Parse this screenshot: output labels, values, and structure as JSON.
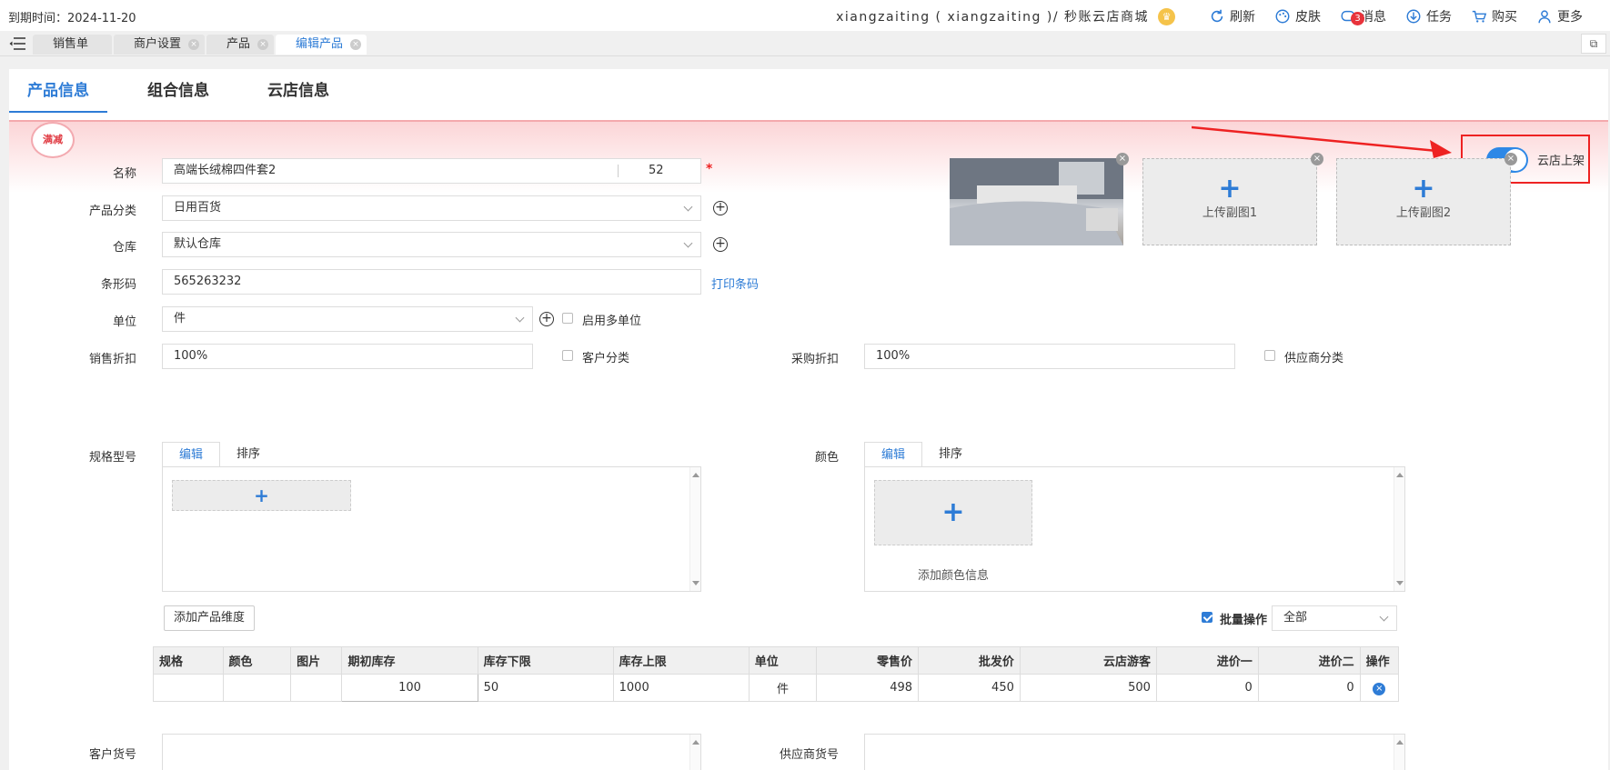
{
  "topbar": {
    "expiry": "到期时间：2024-11-20",
    "account": "xiangzaiting ( xiangzaiting )/ 秒账云店商城",
    "items": [
      {
        "label": "刷新",
        "icon": "refresh-icon"
      },
      {
        "label": "皮肤",
        "icon": "palette-icon"
      },
      {
        "label": "消息",
        "icon": "message-icon",
        "badge": "3"
      },
      {
        "label": "任务",
        "icon": "download-icon"
      },
      {
        "label": "购买",
        "icon": "cart-icon"
      },
      {
        "label": "更多",
        "icon": "user-icon"
      }
    ]
  },
  "tabbar": {
    "tabs": [
      {
        "label": "销售单",
        "active": false
      },
      {
        "label": "商户设置",
        "active": false
      },
      {
        "label": "产品",
        "active": false
      },
      {
        "label": "编辑产品",
        "active": true
      }
    ]
  },
  "content_tabs": [
    "产品信息",
    "组合信息",
    "云店信息"
  ],
  "promo": "满减",
  "cloud_toggle": {
    "label": "云店上架",
    "on": true
  },
  "form": {
    "name_label": "名称",
    "name_value": "高端长绒棉四件套2",
    "name_count": "52",
    "category_label": "产品分类",
    "category_value": "日用百货",
    "warehouse_label": "仓库",
    "warehouse_value": "默认仓库",
    "barcode_label": "条形码",
    "barcode_value": "565263232",
    "print_barcode": "打印条码",
    "unit_label": "单位",
    "unit_value": "件",
    "multi_unit": "启用多单位",
    "sales_discount_label": "销售折扣",
    "sales_discount_value": "100%",
    "customer_category": "客户分类",
    "purchase_discount_label": "采购折扣",
    "purchase_discount_value": "100%",
    "supplier_category": "供应商分类",
    "spec_label": "规格型号",
    "color_label": "颜色",
    "panel_tab_edit": "编辑",
    "panel_tab_sort": "排序",
    "add_color_info": "添加颜色信息",
    "add_dimension": "添加产品维度",
    "batch_op": "批量操作",
    "batch_select": "全部",
    "customer_sku_label": "客户货号",
    "supplier_sku_label": "供应商货号"
  },
  "images": [
    {
      "label": "",
      "filled": true
    },
    {
      "label": "上传副图1",
      "filled": false
    },
    {
      "label": "上传副图2",
      "filled": false
    }
  ],
  "table": {
    "headers": [
      "规格",
      "颜色",
      "图片",
      "期初库存",
      "库存下限",
      "库存上限",
      "单位",
      "零售价",
      "批发价",
      "云店游客",
      "进价一",
      "进价二",
      "操作"
    ],
    "rows": [
      [
        "",
        "",
        "",
        "100",
        "50",
        "1000",
        "件",
        "498",
        "450",
        "500",
        "0",
        "0",
        ""
      ]
    ]
  }
}
